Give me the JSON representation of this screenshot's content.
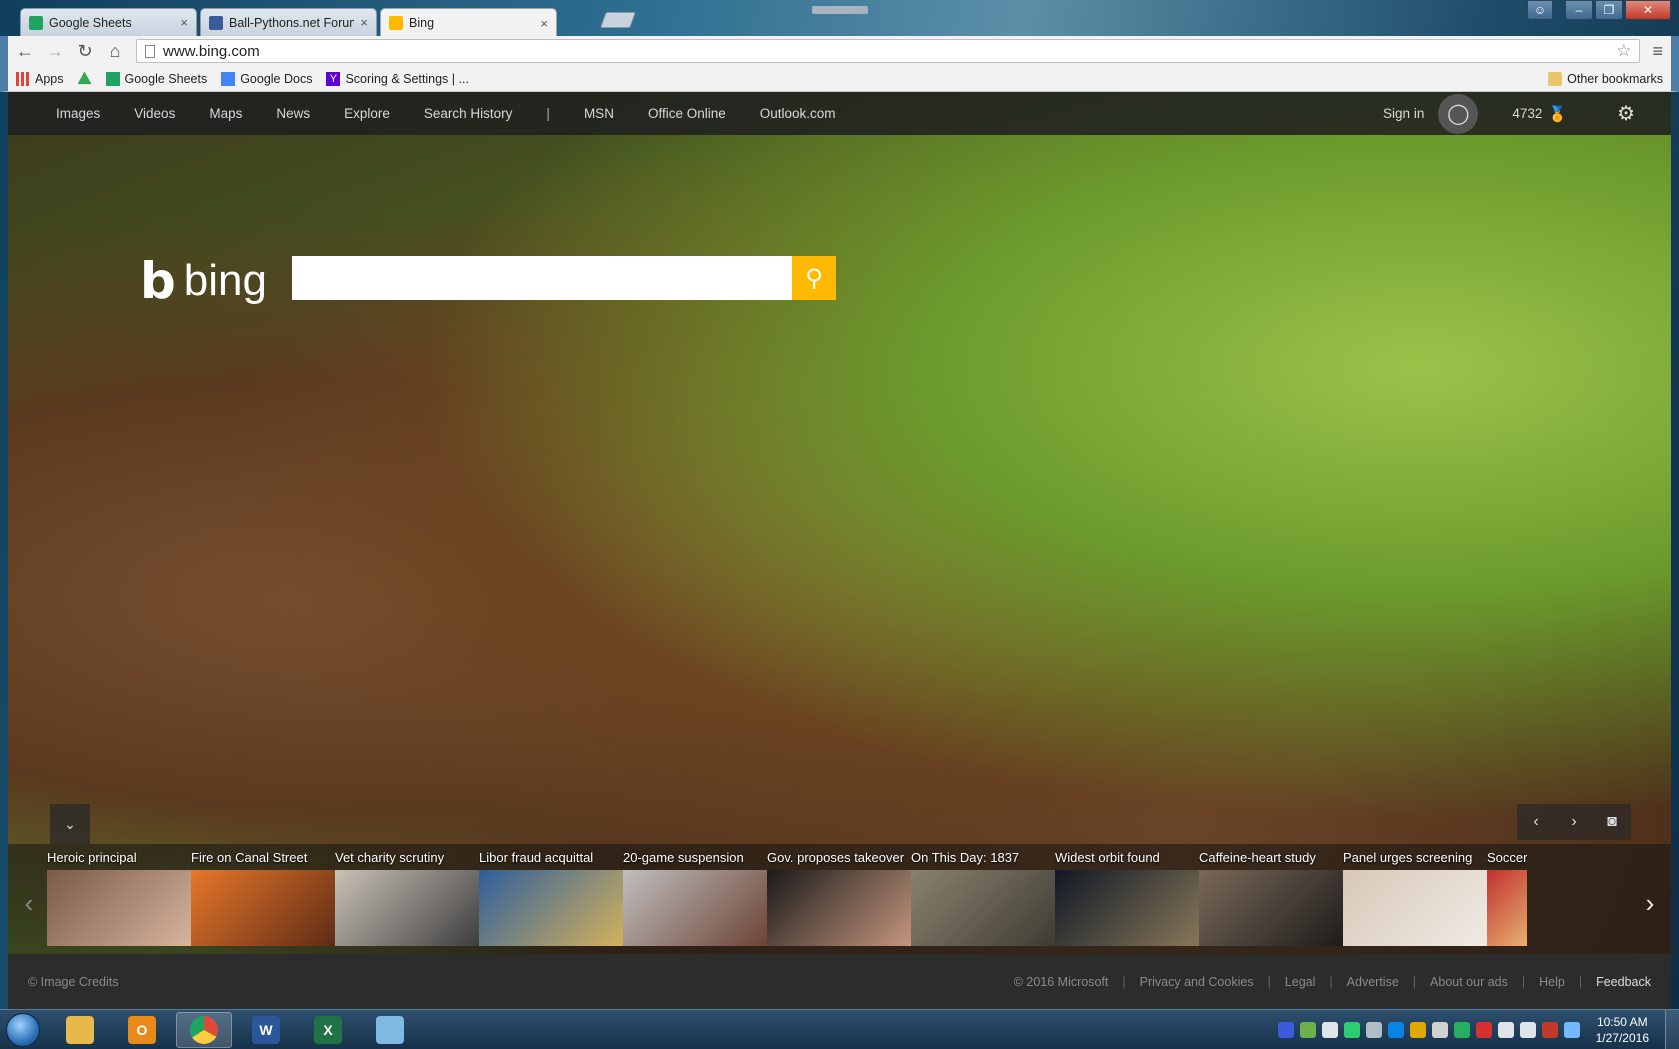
{
  "browser": {
    "tabs": [
      {
        "title": "Google Sheets",
        "close": "×",
        "favicon_color": "#1fa463",
        "active": false
      },
      {
        "title": "Ball-Pythons.net Forums",
        "close": "×",
        "favicon_color": "#3b5998",
        "active": false
      },
      {
        "title": "Bing",
        "close": "×",
        "favicon_color": "#ffb900",
        "active": true
      }
    ],
    "nav": {
      "back": "←",
      "forward": "→",
      "reload": "↻",
      "home": "⌂",
      "star": "☆",
      "menu": "≡"
    },
    "address": "www.bing.com",
    "window_buttons": {
      "minimize": "–",
      "maximize": "❐",
      "close": "✕"
    }
  },
  "bookmarks": [
    {
      "label": "Apps",
      "icon": "apps-grid-icon",
      "color": "#e0443a"
    },
    {
      "label": "",
      "icon": "google-drive-icon",
      "color": "#34a853"
    },
    {
      "label": "Google Sheets",
      "icon": "sheets-icon",
      "color": "#1fa463"
    },
    {
      "label": "Google Docs",
      "icon": "docs-icon",
      "color": "#4285f4"
    },
    {
      "label": "Scoring & Settings | ...",
      "icon": "yahoo-icon",
      "color": "#5f01d1"
    }
  ],
  "other_bookmarks": "Other bookmarks",
  "bing": {
    "nav_links": [
      "Images",
      "Videos",
      "Maps",
      "News",
      "Explore",
      "Search History"
    ],
    "nav_divider": "|",
    "nav_links2": [
      "MSN",
      "Office Online",
      "Outlook.com"
    ],
    "sign_in": "Sign in",
    "rewards": "4732",
    "logo_word": "bing",
    "search_placeholder": "",
    "search_icon": "⚲",
    "expand_icon": "⌄",
    "prev_icon": "‹",
    "next_icon": "›",
    "camera_icon": "◙",
    "carousel": [
      {
        "caption": "Heroic principal",
        "colors": [
          "#7a5a48",
          "#d9b7a0"
        ]
      },
      {
        "caption": "Fire on Canal Street",
        "colors": [
          "#e8772a",
          "#5a2a14"
        ]
      },
      {
        "caption": "Vet charity scrutiny",
        "colors": [
          "#c9c2b8",
          "#3a3a3a"
        ]
      },
      {
        "caption": "Libor fraud acquittal",
        "colors": [
          "#2e5e9c",
          "#d8b45a"
        ]
      },
      {
        "caption": "20-game suspension",
        "colors": [
          "#bfbfbf",
          "#6a4030"
        ]
      },
      {
        "caption": "Gov. proposes takeover",
        "colors": [
          "#1a1a1a",
          "#c99a80"
        ]
      },
      {
        "caption": "On This Day: 1837",
        "colors": [
          "#8a8270",
          "#3c3a30"
        ]
      },
      {
        "caption": "Widest orbit found",
        "colors": [
          "#101826",
          "#8a7a5a"
        ]
      },
      {
        "caption": "Caffeine-heart study",
        "colors": [
          "#7a6858",
          "#1a1a1a"
        ]
      },
      {
        "caption": "Panel urges screening",
        "colors": [
          "#d8c8b8",
          "#f0ece6"
        ]
      },
      {
        "caption": "Soccer",
        "colors": [
          "#c03030",
          "#e8b070"
        ]
      }
    ],
    "footer": {
      "credits": "© Image Credits",
      "links": [
        "© 2016 Microsoft",
        "Privacy and Cookies",
        "Legal",
        "Advertise",
        "About our ads",
        "Help"
      ],
      "feedback": "Feedback"
    }
  },
  "taskbar": {
    "apps": [
      {
        "name": "file-explorer-icon",
        "label": "",
        "color": "#e8b84a"
      },
      {
        "name": "outlook-icon",
        "label": "O",
        "color": "#e88a1a"
      },
      {
        "name": "chrome-icon",
        "label": "",
        "color": "#dd4b39"
      },
      {
        "name": "word-icon",
        "label": "W",
        "color": "#2b579a"
      },
      {
        "name": "excel-icon",
        "label": "X",
        "color": "#217346"
      },
      {
        "name": "notepad-icon",
        "label": "",
        "color": "#7fb8e0"
      }
    ],
    "tray_colors": [
      "#3b5bdb",
      "#6ab04c",
      "#dfe6e9",
      "#2ecc71",
      "#b2bec3",
      "#0984e3",
      "#e1a800",
      "#d0d0d0",
      "#27ae60",
      "#d63031",
      "#dfe6e9",
      "#dfe6e9",
      "#c0392b",
      "#74b9ff"
    ],
    "time": "10:50 AM",
    "date": "1/27/2016"
  }
}
